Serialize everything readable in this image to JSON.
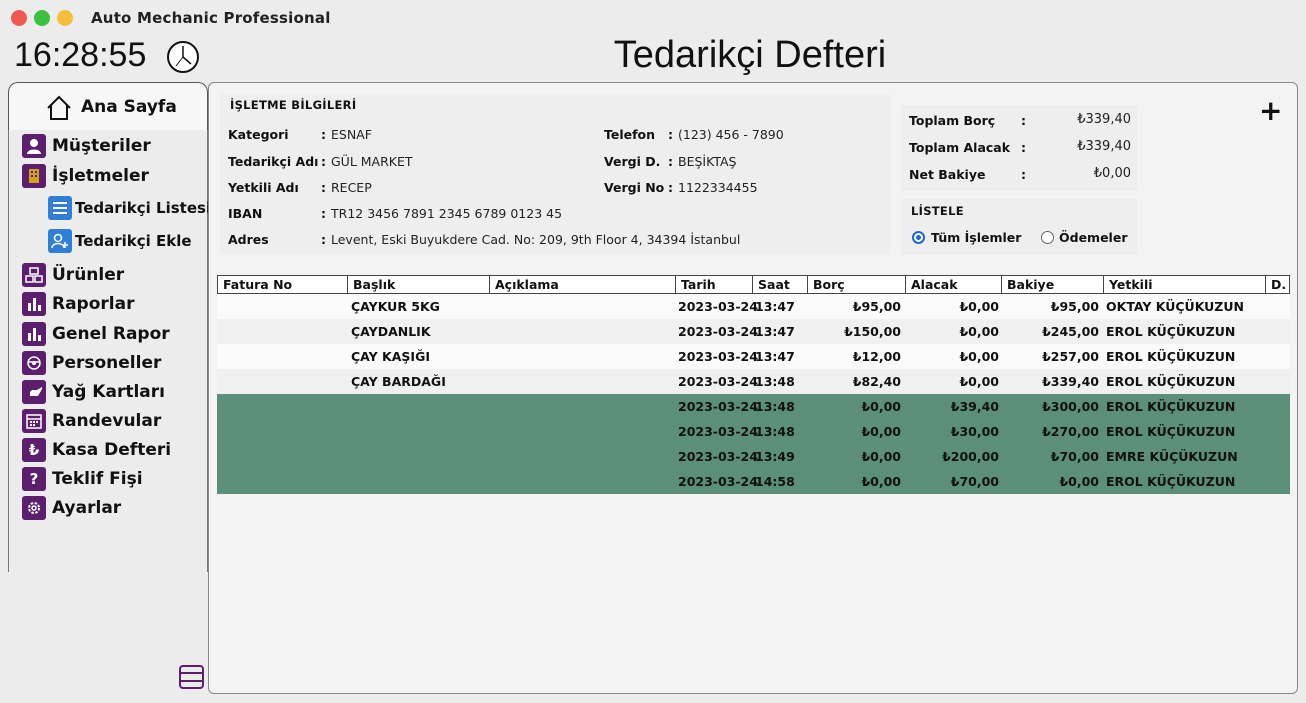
{
  "window": {
    "title": "Auto Mechanic Professional"
  },
  "clock": {
    "time": "16:28:55"
  },
  "page": {
    "title": "Tedarikçi Defteri"
  },
  "sidebar": {
    "home": "Ana Sayfa",
    "items": [
      {
        "label": "Müşteriler",
        "icon": "user-icon"
      },
      {
        "label": "İşletmeler",
        "icon": "building-icon"
      },
      {
        "label": "Ürünler",
        "icon": "boxes-icon"
      },
      {
        "label": "Raporlar",
        "icon": "bar-chart-icon"
      },
      {
        "label": "Genel Rapor",
        "icon": "bar-chart-icon"
      },
      {
        "label": "Personeller",
        "icon": "worker-icon"
      },
      {
        "label": "Yağ Kartları",
        "icon": "oil-can-icon"
      },
      {
        "label": "Randevular",
        "icon": "calendar-icon"
      },
      {
        "label": "Kasa Defteri",
        "icon": "lira-icon"
      },
      {
        "label": "Teklif Fişi",
        "icon": "question-icon"
      },
      {
        "label": "Ayarlar",
        "icon": "gear-icon"
      }
    ],
    "subitems": [
      {
        "label": "Tedarikçi Listesi",
        "icon": "list-icon"
      },
      {
        "label": "Tedarikçi Ekle",
        "icon": "add-user-icon"
      }
    ]
  },
  "info": {
    "section_title": "İŞLETME BİLGİLERİ",
    "left": [
      {
        "label": "Kategori",
        "value": "ESNAF"
      },
      {
        "label": "Tedarikçi Adı",
        "value": "GÜL MARKET"
      },
      {
        "label": "Yetkili Adı",
        "value": "RECEP"
      },
      {
        "label": "IBAN",
        "value": "TR12 3456 7891 2345 6789 0123 45"
      },
      {
        "label": "Adres",
        "value": "Levent, Eski Buyukdere Cad. No: 209, 9th Floor 4, 34394 İstanbul"
      }
    ],
    "right": [
      {
        "label": "Telefon",
        "value": "(123) 456 - 7890"
      },
      {
        "label": "Vergi D.",
        "value": "BEŞİKTAŞ"
      },
      {
        "label": "Vergi No",
        "value": "1122334455"
      }
    ],
    "colon": ":"
  },
  "totals": [
    {
      "label": "Toplam Borç",
      "value": "₺339,40"
    },
    {
      "label": "Toplam Alacak",
      "value": "₺339,40"
    },
    {
      "label": "Net Bakiye",
      "value": "₺0,00"
    }
  ],
  "listele": {
    "title": "LİSTELE",
    "options": [
      {
        "label": "Tüm İşlemler",
        "selected": true
      },
      {
        "label": "Ödemeler",
        "selected": false
      }
    ]
  },
  "add_button": "+",
  "table": {
    "columns": [
      "Fatura No",
      "Başlık",
      "Açıklama",
      "Tarih",
      "Saat",
      "Borç",
      "Alacak",
      "Bakiye",
      "Yetkili",
      "D."
    ],
    "rows": [
      {
        "fatura": "",
        "baslik": "ÇAYKUR 5KG",
        "aciklama": "",
        "tarih": "2023-03-24",
        "saat": "13:47",
        "borc": "₺95,00",
        "alacak": "₺0,00",
        "bakiye": "₺95,00",
        "yetkili": "OKTAY KÜÇÜKUZUN",
        "type": "purchase"
      },
      {
        "fatura": "",
        "baslik": "ÇAYDANLIK",
        "aciklama": "",
        "tarih": "2023-03-24",
        "saat": "13:47",
        "borc": "₺150,00",
        "alacak": "₺0,00",
        "bakiye": "₺245,00",
        "yetkili": "EROL KÜÇÜKUZUN",
        "type": "purchase"
      },
      {
        "fatura": "",
        "baslik": "ÇAY KAŞIĞI",
        "aciklama": "",
        "tarih": "2023-03-24",
        "saat": "13:47",
        "borc": "₺12,00",
        "alacak": "₺0,00",
        "bakiye": "₺257,00",
        "yetkili": "EROL KÜÇÜKUZUN",
        "type": "purchase"
      },
      {
        "fatura": "",
        "baslik": "ÇAY BARDAĞI",
        "aciklama": "",
        "tarih": "2023-03-24",
        "saat": "13:48",
        "borc": "₺82,40",
        "alacak": "₺0,00",
        "bakiye": "₺339,40",
        "yetkili": "EROL KÜÇÜKUZUN",
        "type": "purchase"
      },
      {
        "fatura": "",
        "baslik": "",
        "aciklama": "",
        "tarih": "2023-03-24",
        "saat": "13:48",
        "borc": "₺0,00",
        "alacak": "₺39,40",
        "bakiye": "₺300,00",
        "yetkili": "EROL KÜÇÜKUZUN",
        "type": "payment"
      },
      {
        "fatura": "",
        "baslik": "",
        "aciklama": "",
        "tarih": "2023-03-24",
        "saat": "13:48",
        "borc": "₺0,00",
        "alacak": "₺30,00",
        "bakiye": "₺270,00",
        "yetkili": "EROL KÜÇÜKUZUN",
        "type": "payment"
      },
      {
        "fatura": "",
        "baslik": "",
        "aciklama": "",
        "tarih": "2023-03-24",
        "saat": "13:49",
        "borc": "₺0,00",
        "alacak": "₺200,00",
        "bakiye": "₺70,00",
        "yetkili": "EMRE KÜÇÜKUZUN",
        "type": "payment"
      },
      {
        "fatura": "",
        "baslik": "",
        "aciklama": "",
        "tarih": "2023-03-24",
        "saat": "14:58",
        "borc": "₺0,00",
        "alacak": "₺70,00",
        "bakiye": "₺0,00",
        "yetkili": "EROL KÜÇÜKUZUN",
        "type": "payment"
      }
    ]
  },
  "colors": {
    "accent_purple": "#5b1f6e",
    "accent_blue": "#2f7fd4",
    "payment_row": "#5b8f7a"
  }
}
